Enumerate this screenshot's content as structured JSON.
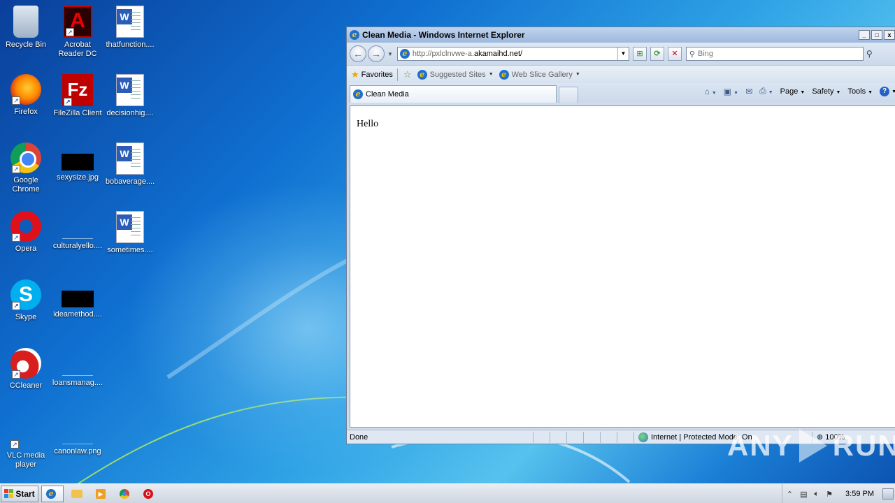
{
  "desktop": {
    "icons": [
      {
        "label": "Recycle Bin"
      },
      {
        "label": "Acrobat Reader DC"
      },
      {
        "label": "thatfunction...."
      },
      {
        "label": "Firefox"
      },
      {
        "label": "FileZilla Client"
      },
      {
        "label": "decisionhig...."
      },
      {
        "label": "Google Chrome"
      },
      {
        "label": "sexysize.jpg"
      },
      {
        "label": "bobaverage...."
      },
      {
        "label": "Opera"
      },
      {
        "label": "culturalyello...."
      },
      {
        "label": "sometimes...."
      },
      {
        "label": "Skype"
      },
      {
        "label": "ideamethod...."
      },
      {
        "label": "CCleaner"
      },
      {
        "label": "loansmanag...."
      },
      {
        "label": "VLC media player"
      },
      {
        "label": "canonlaw.png"
      }
    ]
  },
  "ie": {
    "title": "Clean Media - Windows Internet Explorer",
    "address_prefix": "http://pxlclnvwe-a.",
    "address_domain": "akamaihd.net/",
    "search_placeholder": "Bing",
    "favorites_label": "Favorites",
    "suggested_sites": "Suggested Sites",
    "web_slice_gallery": "Web Slice Gallery",
    "tab_title": "Clean Media",
    "cmd_page": "Page",
    "cmd_safety": "Safety",
    "cmd_tools": "Tools",
    "page_text": "Hello",
    "status_text": "Done",
    "zone_text": "Internet | Protected Mode: On",
    "zoom": "100%"
  },
  "watermark": {
    "left": "ANY",
    "right": "RUN"
  },
  "taskbar": {
    "start_label": "Start",
    "clock": "3:59 PM"
  }
}
